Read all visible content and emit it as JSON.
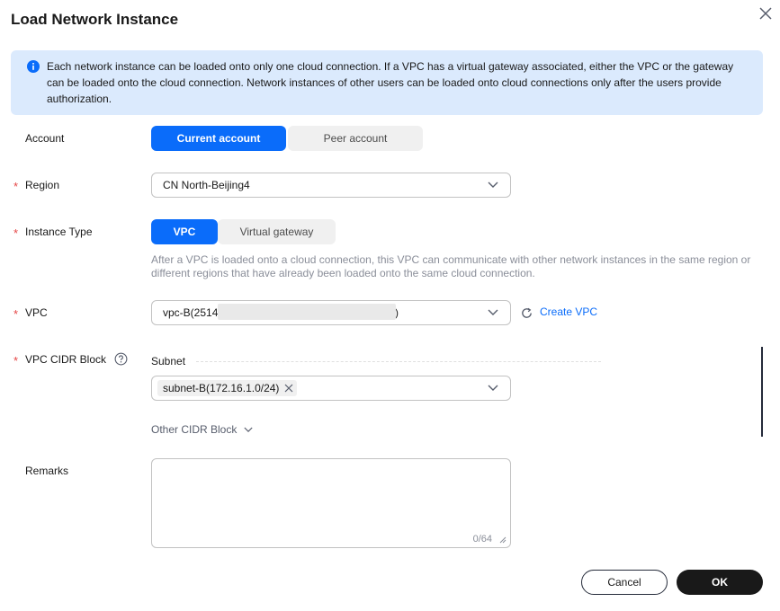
{
  "dialog": {
    "title": "Load Network Instance",
    "info_text": "Each network instance can be loaded onto only one cloud connection. If a VPC has a virtual gateway associated, either the VPC or the gateway can be loaded onto the cloud connection. Network instances of other users can be loaded onto cloud connections only after the users provide authorization."
  },
  "form": {
    "account": {
      "label": "Account",
      "options": [
        "Current account",
        "Peer account"
      ],
      "selected": "Current account"
    },
    "region": {
      "label": "Region",
      "value": "CN North-Beijing4",
      "required": true
    },
    "instance_type": {
      "label": "Instance Type",
      "options": [
        "VPC",
        "Virtual gateway"
      ],
      "selected": "VPC",
      "hint": "After a VPC is loaded onto a cloud connection, this VPC can communicate with other network instances in the same region or different regions that have already been loaded onto the same cloud connection.",
      "required": true
    },
    "vpc": {
      "label": "VPC",
      "value_prefix": "vpc-B(2514",
      "value_suffix": ")",
      "create_link": "Create VPC",
      "required": true
    },
    "cidr": {
      "label": "VPC CIDR Block",
      "subnet_label": "Subnet",
      "subnet_tag": "subnet-B(172.16.1.0/24)",
      "other_label": "Other CIDR Block",
      "required": true
    },
    "remarks": {
      "label": "Remarks",
      "counter": "0/64"
    }
  },
  "buttons": {
    "cancel": "Cancel",
    "ok": "OK"
  },
  "colors": {
    "primary": "#0a6cfa",
    "info_bg": "#dbeafd",
    "required": "#e54545",
    "dark": "#191919"
  },
  "icons": [
    "close-icon",
    "info-icon",
    "chevron-down-icon",
    "refresh-icon",
    "help-icon",
    "tag-remove-icon",
    "resize-icon"
  ]
}
